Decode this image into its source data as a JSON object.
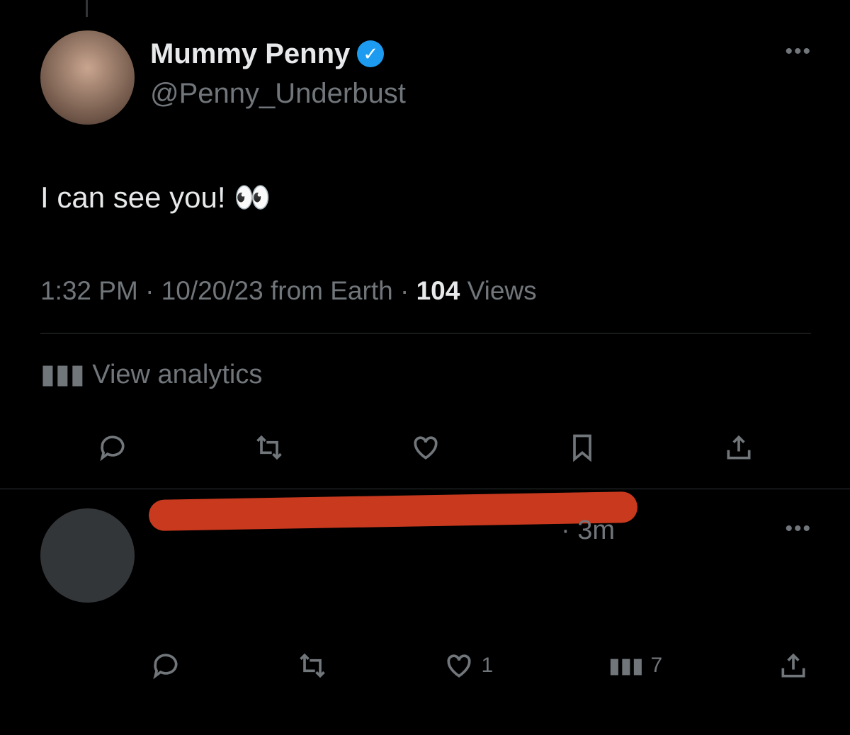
{
  "tweet": {
    "display_name": "Mummy Penny",
    "handle": "@Penny_Underbust",
    "text": "I can see you! 👀",
    "time": "1:32 PM · 10/20/23 from Earth · ",
    "views_count": "104",
    "views_label": " Views",
    "analytics_label": "View analytics"
  },
  "reply": {
    "time": "· 3m",
    "text": "",
    "like_count": "1",
    "view_count": "7"
  },
  "colors": {
    "background": "#000000",
    "text": "#e7e9ea",
    "muted": "#71767b",
    "verified": "#1d9bf0",
    "redaction": "#c9391e"
  }
}
